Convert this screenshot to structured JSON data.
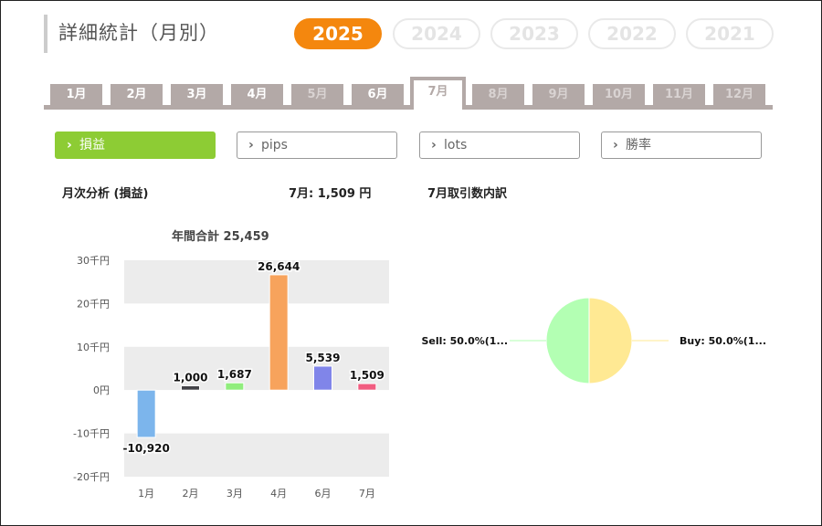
{
  "page_title": "詳細統計（月別）",
  "years": [
    {
      "label": "2025",
      "active": true
    },
    {
      "label": "2024",
      "active": false
    },
    {
      "label": "2023",
      "active": false
    },
    {
      "label": "2022",
      "active": false
    },
    {
      "label": "2021",
      "active": false
    }
  ],
  "months": [
    {
      "label": "1月",
      "state": "enabled"
    },
    {
      "label": "2月",
      "state": "enabled"
    },
    {
      "label": "3月",
      "state": "enabled"
    },
    {
      "label": "4月",
      "state": "enabled"
    },
    {
      "label": "5月",
      "state": "disabled"
    },
    {
      "label": "6月",
      "state": "enabled"
    },
    {
      "label": "7月",
      "state": "active"
    },
    {
      "label": "8月",
      "state": "disabled"
    },
    {
      "label": "9月",
      "state": "disabled"
    },
    {
      "label": "10月",
      "state": "disabled"
    },
    {
      "label": "11月",
      "state": "disabled"
    },
    {
      "label": "12月",
      "state": "disabled"
    }
  ],
  "metrics": [
    {
      "label": "損益",
      "active": true
    },
    {
      "label": "pips",
      "active": false
    },
    {
      "label": "lots",
      "active": false
    },
    {
      "label": "勝率",
      "active": false
    }
  ],
  "analysis_heading": "月次分析 (損益)",
  "month_value": "7月:  1,509 円",
  "breakdown_heading": "7月取引数内訳",
  "colors": {
    "accent": "#f4870e",
    "metric_active": "#8dcc34",
    "tab": "#b3a9a7"
  },
  "chart_data": [
    {
      "type": "bar",
      "title": "年間合計 25,459",
      "categories": [
        "1月",
        "2月",
        "3月",
        "4月",
        "6月",
        "7月"
      ],
      "values": [
        -10920,
        1000,
        1687,
        26644,
        5539,
        1509
      ],
      "value_labels": [
        "-10,920",
        "1,000",
        "1,687",
        "26,644",
        "5,539",
        "1,509"
      ],
      "colors": [
        "#7cb5ec",
        "#434348",
        "#90ed7d",
        "#f7a35c",
        "#8085e9",
        "#f15c80"
      ],
      "y_ticks": [
        30000,
        20000,
        10000,
        0,
        -10000,
        -20000
      ],
      "y_tick_labels": [
        "30千円",
        "20千円",
        "10千円",
        "0円",
        "-10千円",
        "-20千円"
      ],
      "ylim": [
        -20000,
        30000
      ],
      "grid": "alternating bands"
    },
    {
      "type": "pie",
      "slices": [
        {
          "label": "Buy: 50.0%(1...",
          "value": 50.0,
          "color": "#ffe993"
        },
        {
          "label": "Sell: 50.0%(1...",
          "value": 50.0,
          "color": "#b3ffb3"
        }
      ]
    }
  ]
}
